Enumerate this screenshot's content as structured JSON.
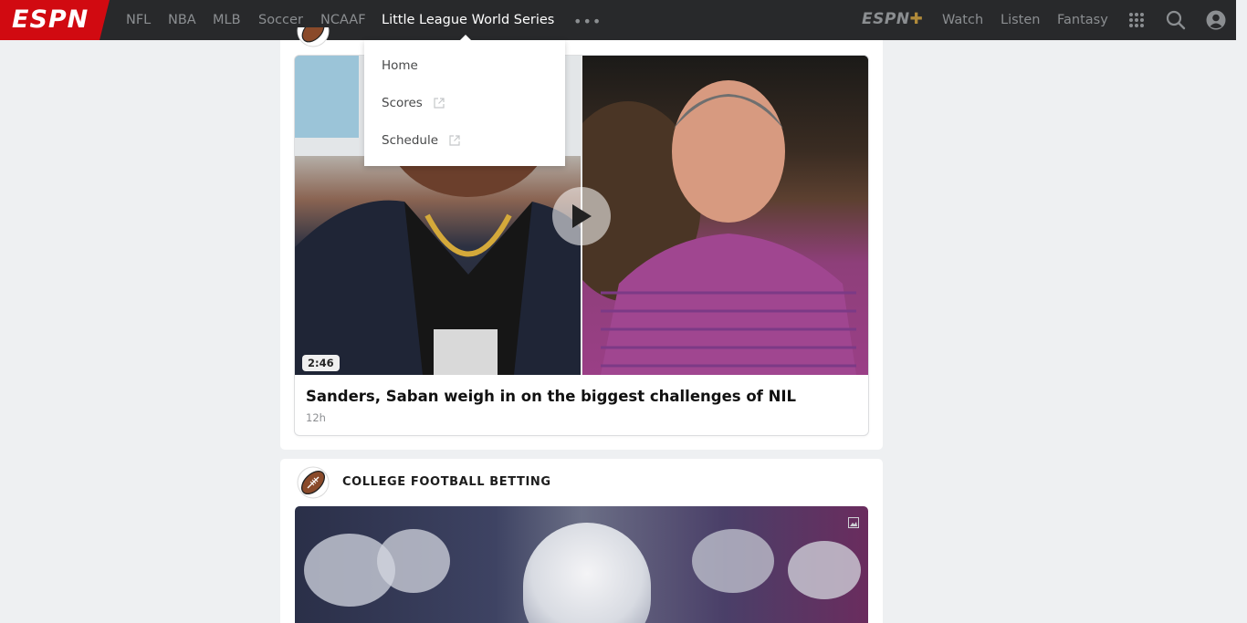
{
  "nav": {
    "logo": "ESPN",
    "links": [
      "NFL",
      "NBA",
      "MLB",
      "Soccer",
      "NCAAF",
      "Little League World Series"
    ],
    "active_link": "Little League World Series",
    "more": "•••",
    "espn_plus": "ESPN",
    "right_links": [
      "Watch",
      "Listen",
      "Fantasy"
    ]
  },
  "dropdown": {
    "items": [
      "Home",
      "Scores",
      "Schedule"
    ]
  },
  "story": {
    "duration": "2:46",
    "headline": "Sanders, Saban weigh in on the biggest challenges of NIL",
    "time": "12h"
  },
  "section": {
    "title": "COLLEGE FOOTBALL BETTING"
  },
  "colors": {
    "nav_bg": "#28292b",
    "brand_red": "#d10a11",
    "plus_gold": "#b08a3a",
    "page_bg": "#eef0f2"
  },
  "icons": [
    "apps-grid-icon",
    "search-icon",
    "account-icon",
    "external-link-icon",
    "play-icon",
    "football-icon",
    "image-icon"
  ]
}
